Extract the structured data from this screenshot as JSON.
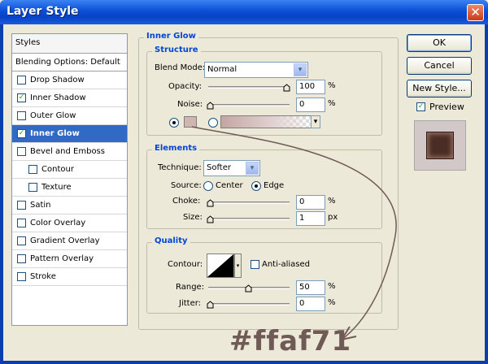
{
  "window": {
    "title": "Layer Style",
    "close": "✕"
  },
  "styles_panel": {
    "header": "Styles",
    "blending_options": "Blending Options: Default",
    "items": [
      {
        "label": "Drop Shadow",
        "checked": false
      },
      {
        "label": "Inner Shadow",
        "checked": true
      },
      {
        "label": "Outer Glow",
        "checked": false
      },
      {
        "label": "Inner Glow",
        "checked": true
      },
      {
        "label": "Bevel and Emboss",
        "checked": false
      },
      {
        "label": "Contour",
        "checked": false
      },
      {
        "label": "Texture",
        "checked": false
      },
      {
        "label": "Satin",
        "checked": false
      },
      {
        "label": "Color Overlay",
        "checked": false
      },
      {
        "label": "Gradient Overlay",
        "checked": false
      },
      {
        "label": "Pattern Overlay",
        "checked": false
      },
      {
        "label": "Stroke",
        "checked": false
      }
    ],
    "checkmark": "✓"
  },
  "inner_glow": {
    "title": "Inner Glow",
    "structure": {
      "title": "Structure",
      "blend_mode_label": "Blend Mode:",
      "blend_mode_value": "Normal",
      "opacity_label": "Opacity:",
      "opacity_value": "100",
      "noise_label": "Noise:",
      "noise_value": "0",
      "unit_percent": "%"
    },
    "elements": {
      "title": "Elements",
      "technique_label": "Technique:",
      "technique_value": "Softer",
      "source_label": "Source:",
      "source_center": "Center",
      "source_edge": "Edge",
      "choke_label": "Choke:",
      "choke_value": "0",
      "size_label": "Size:",
      "size_value": "1",
      "unit_px": "px",
      "unit_percent": "%"
    },
    "quality": {
      "title": "Quality",
      "contour_label": "Contour:",
      "anti_aliased_label": "Anti-aliased",
      "range_label": "Range:",
      "range_value": "50",
      "jitter_label": "Jitter:",
      "jitter_value": "0",
      "unit_percent": "%"
    }
  },
  "buttons": {
    "ok": "OK",
    "cancel": "Cancel",
    "new_style": "New Style...",
    "preview_label": "Preview"
  },
  "annotation": "#ffaf71",
  "colors": {
    "glow_swatch": "#d1b5b0",
    "accent": "#316ac5",
    "title_bar": "#0a4fd6"
  },
  "icons": {
    "dropdown": "▾",
    "close": "close-icon"
  }
}
